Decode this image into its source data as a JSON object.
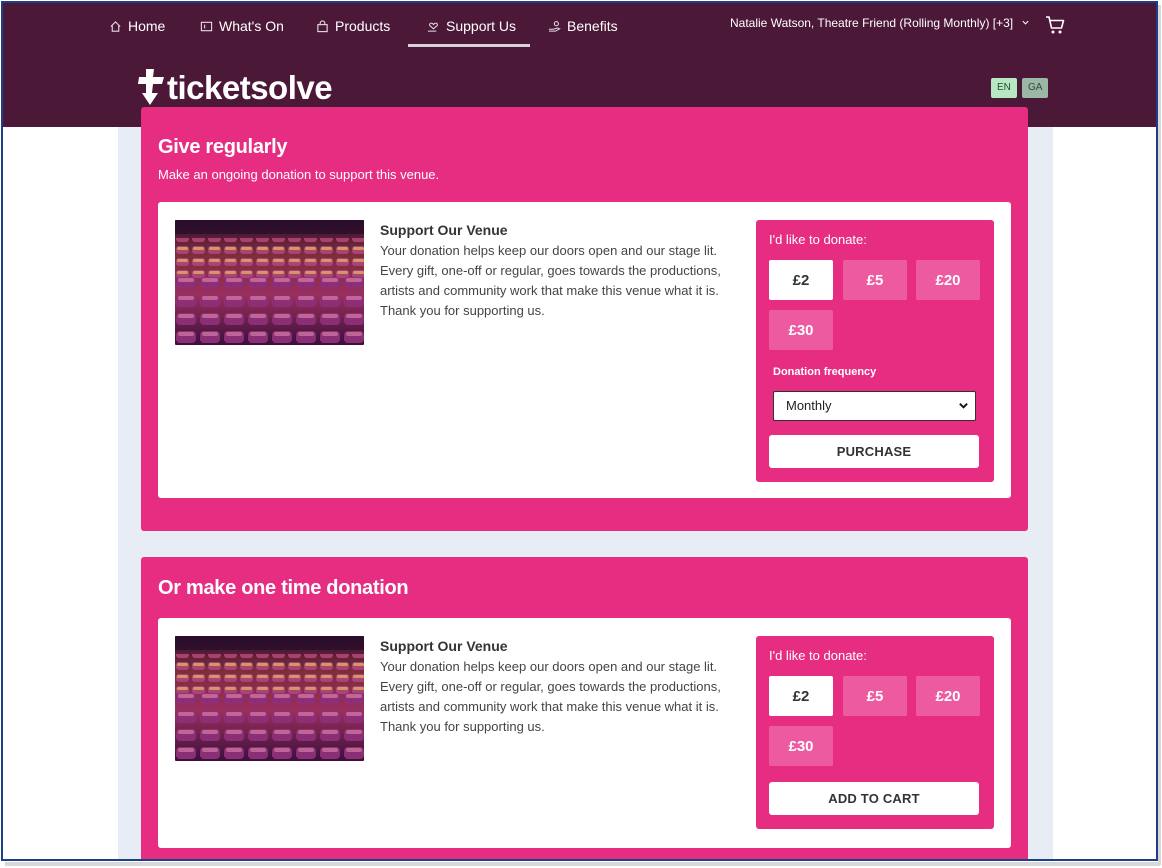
{
  "nav": {
    "items": [
      {
        "label": "Home",
        "icon": "home-icon"
      },
      {
        "label": "What's On",
        "icon": "ticket-icon"
      },
      {
        "label": "Products",
        "icon": "bag-icon"
      },
      {
        "label": "Support Us",
        "icon": "hand-heart-icon"
      },
      {
        "label": "Benefits",
        "icon": "hand-coin-icon"
      }
    ],
    "active": "Support Us",
    "user_label": "Natalie Watson, Theatre Friend (Rolling Monthly) [+3]"
  },
  "brand": {
    "name": "ticketsolve",
    "header_color": "#4c1838",
    "accent": "#e62d82"
  },
  "languages": [
    "EN",
    "GA"
  ],
  "regular": {
    "title": "Give regularly",
    "subtitle": "Make an ongoing donation to support this venue.",
    "card": {
      "title": "Support Our Venue",
      "lines": [
        "Your donation helps keep our doors open and our stage lit.",
        "Every gift, one-off or regular, goes towards the productions,",
        "artists and community work that make this venue what it is.",
        "Thank you for supporting us."
      ]
    },
    "donate": {
      "label": "I'd like to donate:",
      "amounts": [
        "£2",
        "£5",
        "£20",
        "£30"
      ],
      "selected": "£2",
      "frequency_label": "Donation frequency",
      "frequency_value": "Monthly",
      "button": "PURCHASE"
    }
  },
  "one_time": {
    "title": "Or make one time donation",
    "card": {
      "title": "Support Our Venue",
      "lines": [
        "Your donation helps keep our doors open and our stage lit.",
        "Every gift, one-off or regular, goes towards the productions,",
        "artists and community work that make this venue what it is.",
        "Thank you for supporting us."
      ]
    },
    "donate": {
      "label": "I'd like to donate:",
      "amounts": [
        "£2",
        "£5",
        "£20",
        "£30"
      ],
      "selected": "£2",
      "button": "ADD TO CART"
    }
  }
}
